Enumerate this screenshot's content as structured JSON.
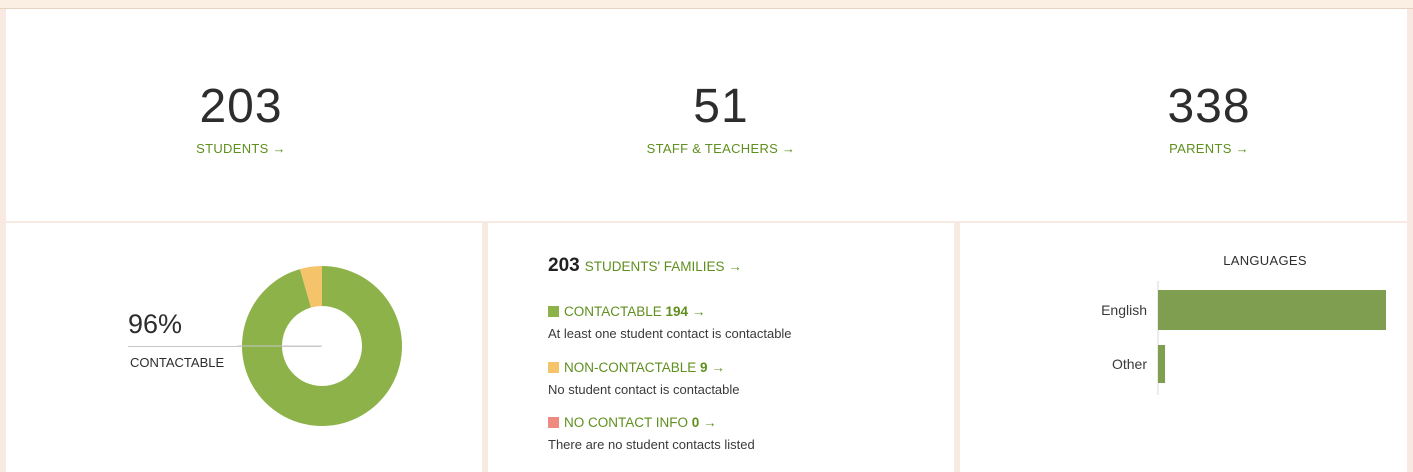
{
  "stats": [
    {
      "value": "203",
      "label": "STUDENTS →"
    },
    {
      "value": "51",
      "label": "STAFF & TEACHERS →"
    },
    {
      "value": "338",
      "label": "PARENTS →"
    }
  ],
  "donut": {
    "percent": "96%",
    "label": "CONTACTABLE",
    "colors": {
      "contactable": "#8db24a",
      "non_contactable": "#f5c46a",
      "no_info": "#ee8a80"
    }
  },
  "families": {
    "count": "203",
    "title": "STUDENTS' FAMILIES →",
    "items": [
      {
        "label": "CONTACTABLE",
        "count": "194",
        "arrow": "→",
        "desc": "At least one student contact is contactable",
        "color": "#8db24a"
      },
      {
        "label": "NON-CONTACTABLE",
        "count": "9",
        "arrow": "→",
        "desc": "No student contact is contactable",
        "color": "#f5c46a"
      },
      {
        "label": "NO CONTACT INFO",
        "count": "0",
        "arrow": "→",
        "desc": "There are no student contacts listed",
        "color": "#ee8a80"
      }
    ]
  },
  "chart_data": [
    {
      "type": "pie",
      "title": "",
      "categories": [
        "CONTACTABLE",
        "NON-CONTACTABLE",
        "NO CONTACT INFO"
      ],
      "values": [
        194,
        9,
        0
      ],
      "colors": [
        "#8db24a",
        "#f5c46a",
        "#ee8a80"
      ]
    },
    {
      "type": "bar",
      "title": "LANGUAGES",
      "categories": [
        "English",
        "Other"
      ],
      "values": [
        97,
        3
      ],
      "orientation": "horizontal",
      "color": "#809e4f"
    }
  ]
}
